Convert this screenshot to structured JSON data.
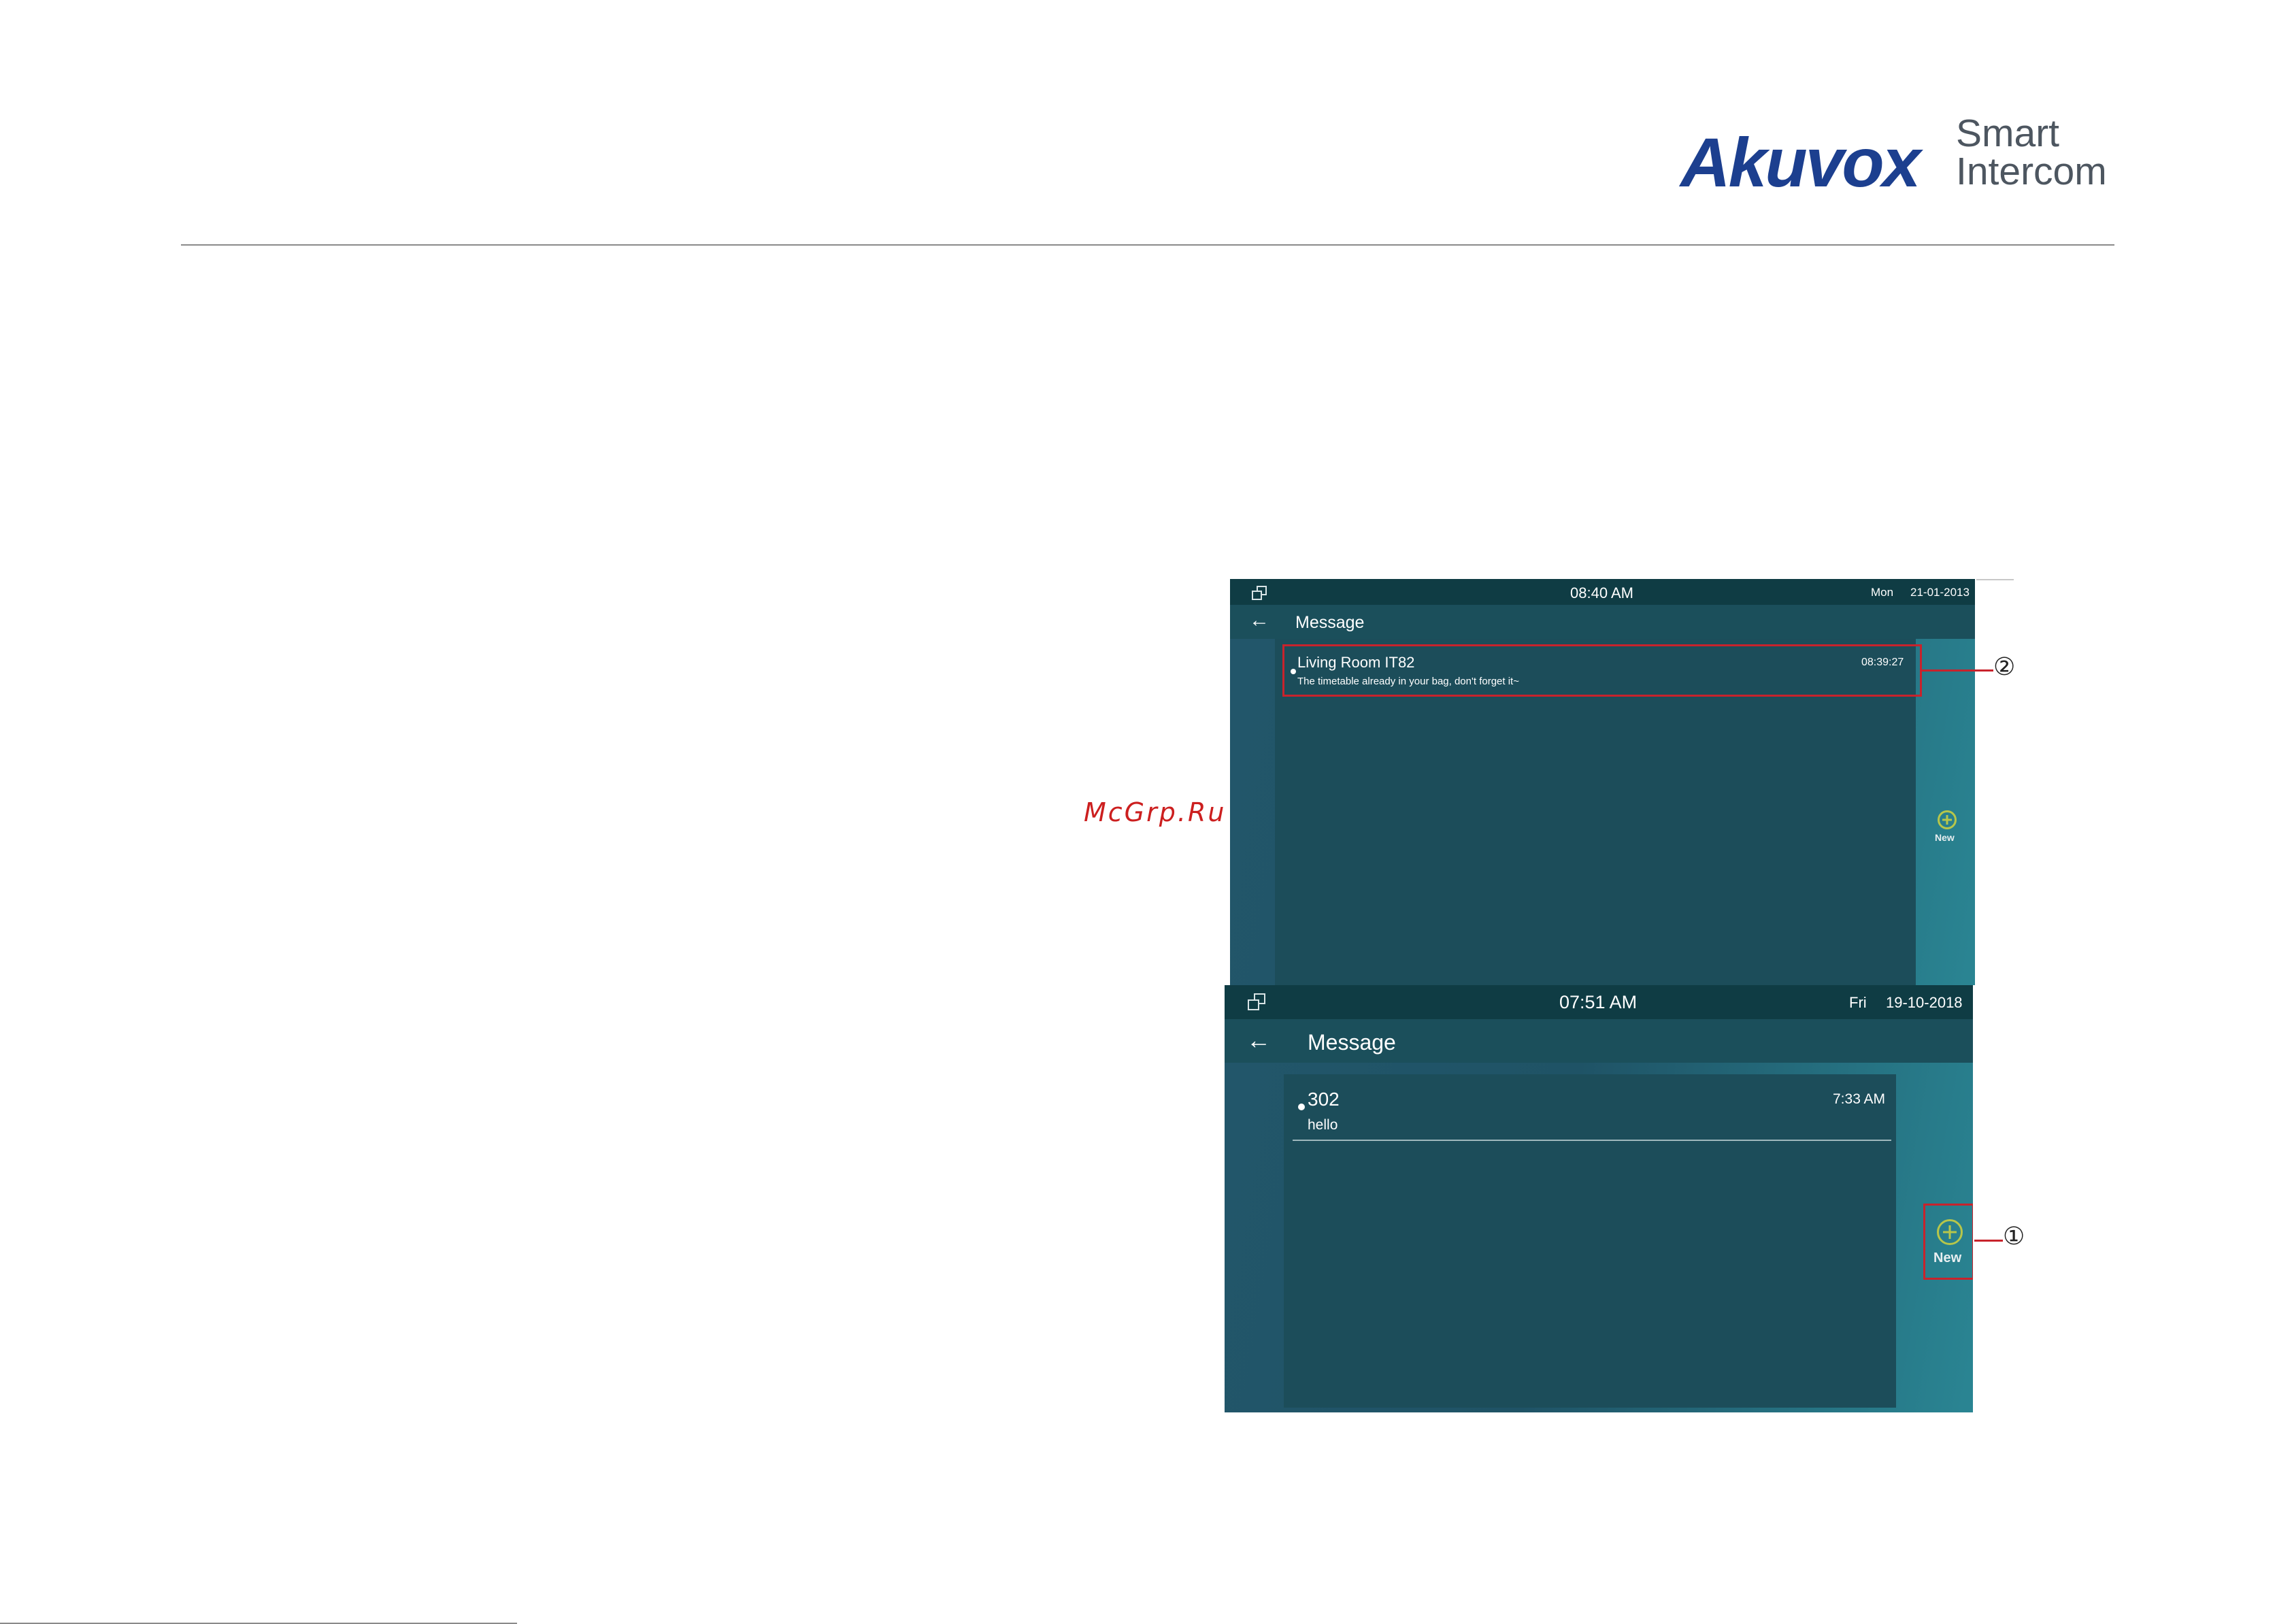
{
  "logo": {
    "brand": "Akuvox",
    "tagline_line1": "Smart",
    "tagline_line2": "Intercom"
  },
  "watermark": "McGrp.Ru",
  "screen_a": {
    "status": {
      "time": "08:40 AM",
      "day": "Mon",
      "date": "21-01-2013"
    },
    "header": {
      "back_icon": "←",
      "title": "Message"
    },
    "messages": [
      {
        "sender": "Living Room IT82",
        "time": "08:39:27",
        "body": "The timetable already in your bag, don't forget it~"
      }
    ],
    "new_button": {
      "icon": "plus-circle-icon",
      "label": "New"
    },
    "callout": "②"
  },
  "screen_b": {
    "status": {
      "time": "07:51 AM",
      "day": "Fri",
      "date": "19-10-2018"
    },
    "header": {
      "back_icon": "←",
      "title": "Message"
    },
    "messages": [
      {
        "sender": "302",
        "time": "7:33 AM",
        "body": "hello"
      }
    ],
    "new_button": {
      "icon": "plus-circle-icon",
      "label": "New"
    },
    "callout": "①"
  },
  "colors": {
    "brand_blue": "#1c3f8f",
    "status_bar": "#0f3c44",
    "title_bar": "#1b4f5b",
    "highlight_red": "#c8232c",
    "plus_icon": "#b7c64a"
  }
}
